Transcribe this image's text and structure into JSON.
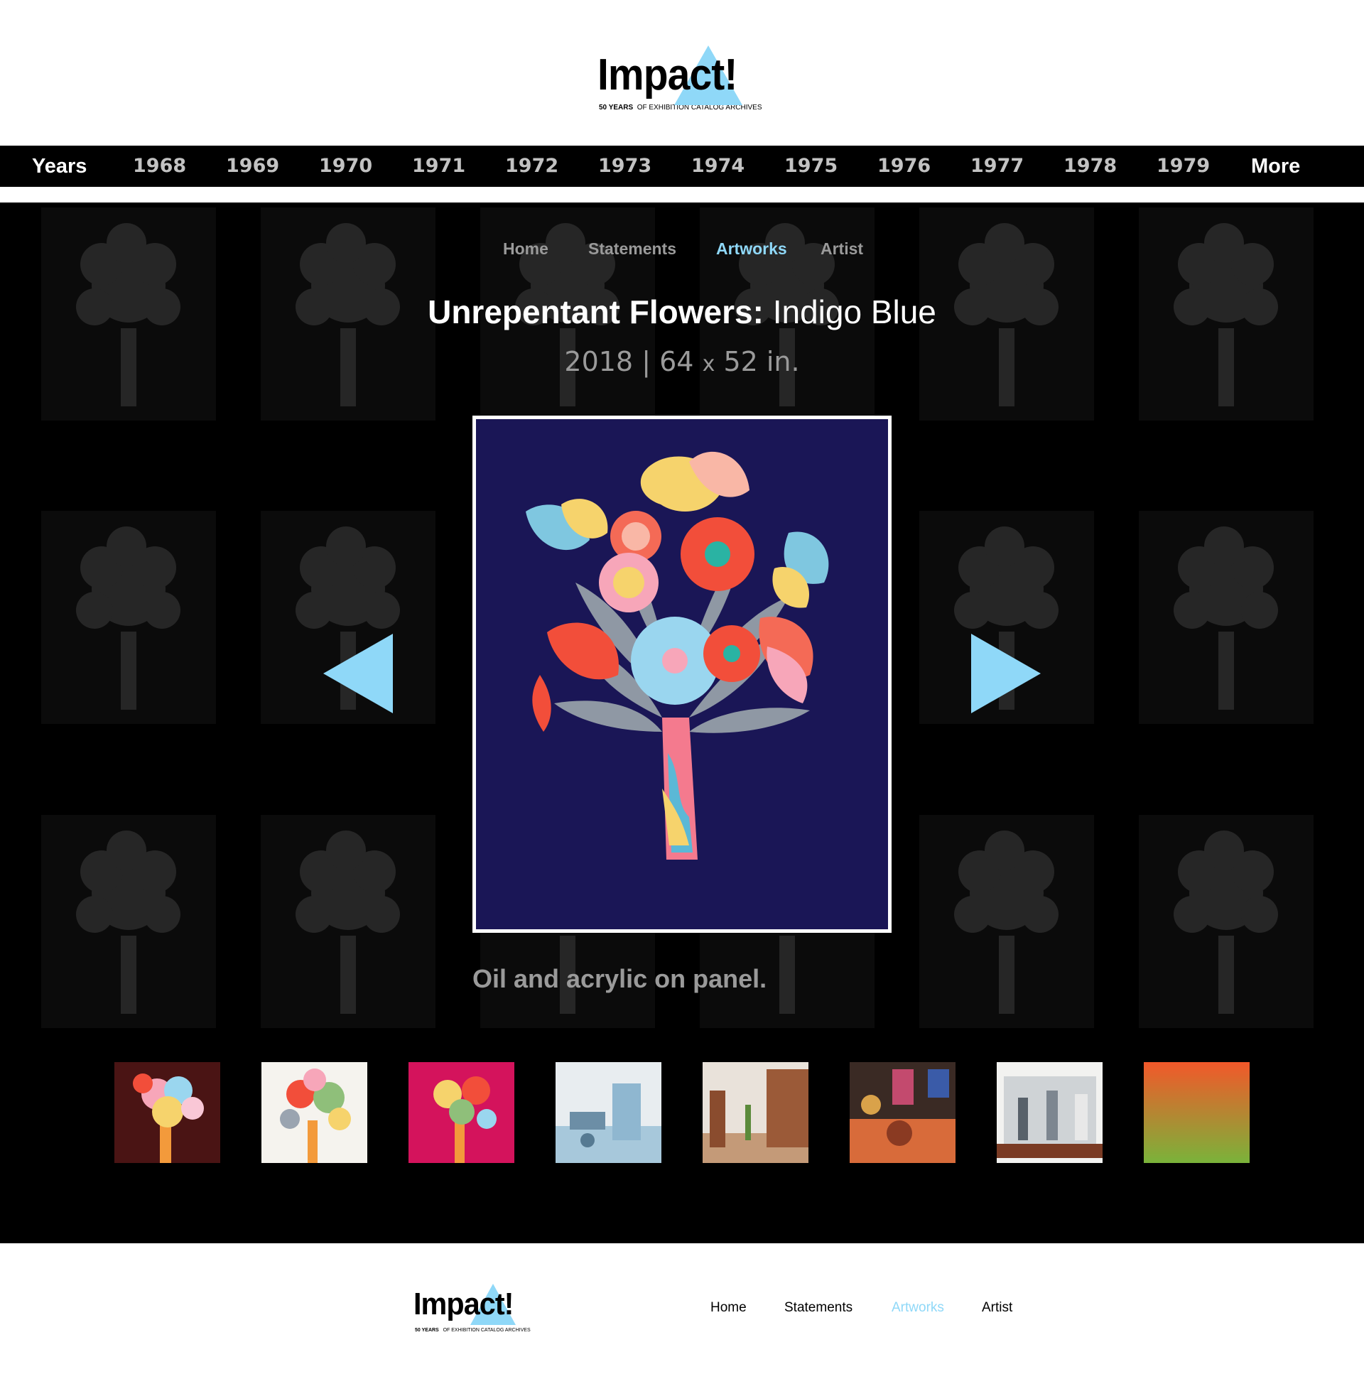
{
  "logo": {
    "word": "Impact!",
    "tag_bold": "50 YEARS",
    "tag_rest": "OF EXHIBITION CATALOG ARCHIVES",
    "accent": "#8fd8f8"
  },
  "years_nav": {
    "heading": "Years",
    "years": [
      "1968",
      "1969",
      "1970",
      "1971",
      "1972",
      "1973",
      "1974",
      "1975",
      "1976",
      "1977",
      "1978",
      "1979"
    ],
    "more": "More"
  },
  "subnav": {
    "items": [
      {
        "label": "Home",
        "active": false
      },
      {
        "label": "Statements",
        "active": false
      },
      {
        "label": "Artworks",
        "active": true
      },
      {
        "label": "Artist",
        "active": false
      }
    ]
  },
  "artwork": {
    "title_bold": "Unrepentant Flowers:",
    "title_rest": "Indigo Blue",
    "year": "2018",
    "separator": "|",
    "dim_a": "64",
    "dim_x": "x",
    "dim_b": "52 in.",
    "medium": "Oil and acrylic on panel.",
    "background_color": "#1a1656"
  },
  "thumbnails": [
    {
      "name": "flowers-maroon"
    },
    {
      "name": "flowers-white"
    },
    {
      "name": "flowers-magenta"
    },
    {
      "name": "blue-machine-installation"
    },
    {
      "name": "wooden-room-installation"
    },
    {
      "name": "orange-diorama"
    },
    {
      "name": "vitrine-figures"
    },
    {
      "name": "orange-green-gradient"
    }
  ],
  "footer": {
    "nav": [
      {
        "label": "Home",
        "active": false
      },
      {
        "label": "Statements",
        "active": false
      },
      {
        "label": "Artworks",
        "active": true
      },
      {
        "label": "Artist",
        "active": false
      }
    ]
  },
  "icons": {
    "prev": "triangle-left-icon",
    "next": "triangle-right-icon"
  }
}
